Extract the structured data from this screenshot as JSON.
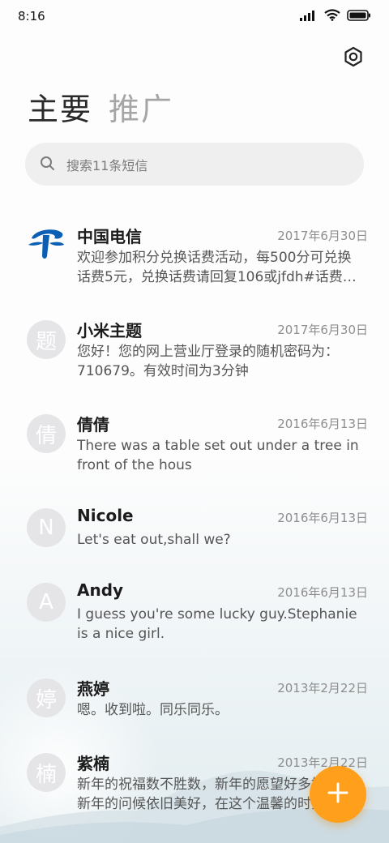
{
  "status_bar": {
    "time": "8:16"
  },
  "header": {
    "tabs": [
      {
        "label": "主要",
        "active": true
      },
      {
        "label": "推广",
        "active": false
      }
    ]
  },
  "search": {
    "placeholder": "搜索11条短信"
  },
  "conversations": [
    {
      "name": "中国电信",
      "avatar": "china-telecom-logo",
      "date": "2017年6月30日",
      "preview": "欢迎参加积分兑换话费活动，每500分可兑换话费5元，兑换话费请回复106或jfdh#话费兑换"
    },
    {
      "name": "小米主题",
      "avatar": "题",
      "date": "2017年6月30日",
      "preview": "您好！您的网上营业厅登录的随机密码为：710679。有效时间为3分钟"
    },
    {
      "name": "倩倩",
      "avatar": "倩",
      "date": "2016年6月13日",
      "preview": "There was a table set out under a tree in front of the hous"
    },
    {
      "name": "Nicole",
      "avatar": "N",
      "date": "2016年6月13日",
      "preview": "Let's eat out,shall we?"
    },
    {
      "name": "Andy",
      "avatar": "A",
      "date": "2016年6月13日",
      "preview": "I guess you're some lucky guy.Stephanie is a nice girl."
    },
    {
      "name": "燕婷",
      "avatar": "婷",
      "date": "2013年2月22日",
      "preview": "嗯。收到啦。同乐同乐。"
    },
    {
      "name": "紫楠",
      "avatar": "楠",
      "date": "2013年2月22日",
      "preview": "新年的祝福数不胜数，新年的愿望好多好多，新年的问候依旧美好，在这个温馨的时刻"
    }
  ],
  "colors": {
    "accent": "#ff9f1c",
    "telecom_blue": "#0a5fb4"
  }
}
